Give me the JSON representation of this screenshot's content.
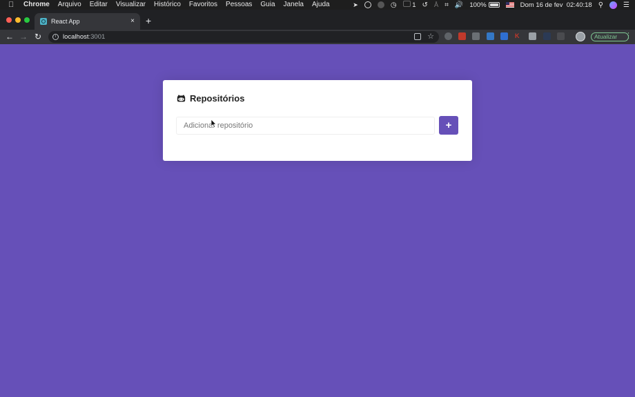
{
  "menubar": {
    "app_name": "Chrome",
    "items": [
      "Arquivo",
      "Editar",
      "Visualizar",
      "Histórico",
      "Favoritos",
      "Pessoas",
      "Guia",
      "Janela",
      "Ajuda"
    ],
    "status_count": "1",
    "battery": "100%",
    "datetime": "Dom 16 de fev  02:40:18"
  },
  "browser": {
    "tab_title": "React App",
    "tab_close": "×",
    "new_tab": "+",
    "url_host": "localhost",
    "url_port": ":3001",
    "update_label": "Atualizar",
    "menu_dots": "⋮"
  },
  "card": {
    "title": "Repositórios",
    "input_placeholder": "Adicionar repositório",
    "add_label": "+"
  },
  "colors": {
    "background": "#6650b8",
    "card": "#ffffff",
    "accent": "#6650b8"
  }
}
